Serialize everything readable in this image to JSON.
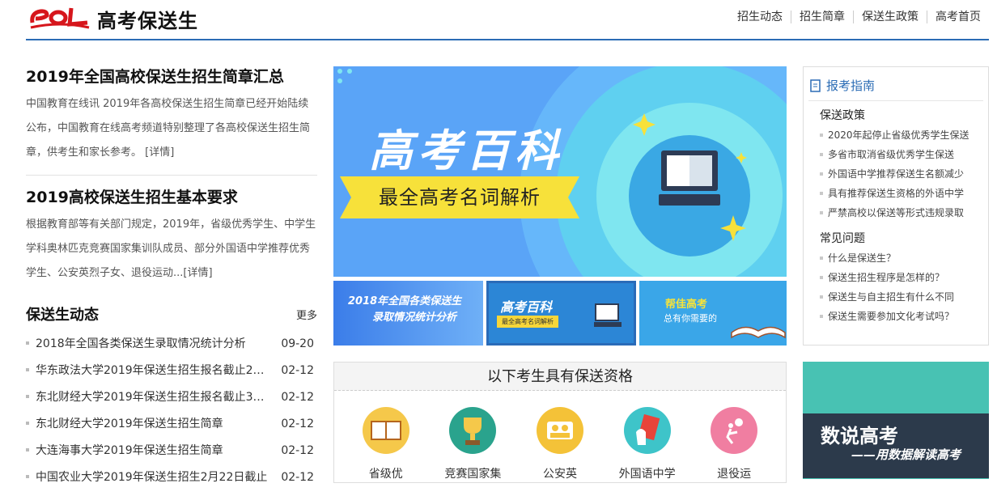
{
  "header": {
    "site_title": "高考保送生",
    "logo_text": "eol",
    "nav": [
      "招生动态",
      "招生简章",
      "保送生政策",
      "高考首页"
    ]
  },
  "articles": [
    {
      "title": "2019年全国高校保送生招生简章汇总",
      "summary": "中国教育在线讯 2019年各高校保送生招生简章已经开始陆续公布，中国教育在线高考频道特别整理了各高校保送生招生简章，供考生和家长参考。",
      "detail_link": "[详情]"
    },
    {
      "title": "2019高校保送生招生基本要求",
      "summary": "根据教育部等有关部门规定，2019年，省级优秀学生、中学生学科奥林匹克竞赛国家集训队成员、部分外国语中学推荐优秀学生、公安英烈子女、退役运动...",
      "detail_link": "[详情]"
    }
  ],
  "news_section": {
    "title": "保送生动态",
    "more": "更多",
    "items": [
      {
        "title": "2018年全国各类保送生录取情况统计分析",
        "date": "09-20"
      },
      {
        "title": "华东政法大学2019年保送生招生报名截止2月...",
        "date": "02-12"
      },
      {
        "title": "东北财经大学2019年保送生招生报名截止3月...",
        "date": "02-12"
      },
      {
        "title": "东北财经大学2019年保送生招生简章",
        "date": "02-12"
      },
      {
        "title": "大连海事大学2019年保送生招生简章",
        "date": "02-12"
      },
      {
        "title": "中国农业大学2019年保送生招生2月22日截止",
        "date": "02-12"
      }
    ]
  },
  "banner": {
    "title": "高考百科",
    "subtitle": "最全高考名词解析"
  },
  "thumbs": {
    "t1_line1": "2018年全国各类保送生",
    "t1_line2": "录取情况统计分析",
    "t2_title": "高考百科",
    "t2_sub": "最全高考名词解析",
    "t3_title": "帮佳高考",
    "t3_sub": "总有你需要的"
  },
  "qualification": {
    "title": "以下考生具有保送资格",
    "items": [
      {
        "label": "省级优",
        "color": "#f5c84a",
        "icon": "book-icon"
      },
      {
        "label": "竞赛国家集",
        "color": "#2aa38d",
        "icon": "trophy-icon"
      },
      {
        "label": "公安英",
        "color": "#f4c238",
        "icon": "people-icon"
      },
      {
        "label": "外国语中学",
        "color": "#3ec4c9",
        "icon": "passport-icon"
      },
      {
        "label": "退役运",
        "color": "#f07ea1",
        "icon": "volleyball-icon"
      }
    ]
  },
  "guide": {
    "title": "报考指南",
    "categories": [
      {
        "name": "保送政策",
        "items": [
          "2020年起停止省级优秀学生保送",
          "多省市取消省级优秀学生保送",
          "外国语中学推荐保送生名额减少",
          "具有推荐保送生资格的外语中学",
          "严禁高校以保送等形式违规录取"
        ]
      },
      {
        "name": "常见问题",
        "items": [
          "什么是保送生？",
          "保送生招生程序是怎样的？",
          "保送生与自主招生有什么不同",
          "保送生需要参加文化考试吗？"
        ]
      }
    ]
  },
  "data_banner": {
    "title": "数说高考",
    "subtitle": "——用数据解读高考"
  }
}
